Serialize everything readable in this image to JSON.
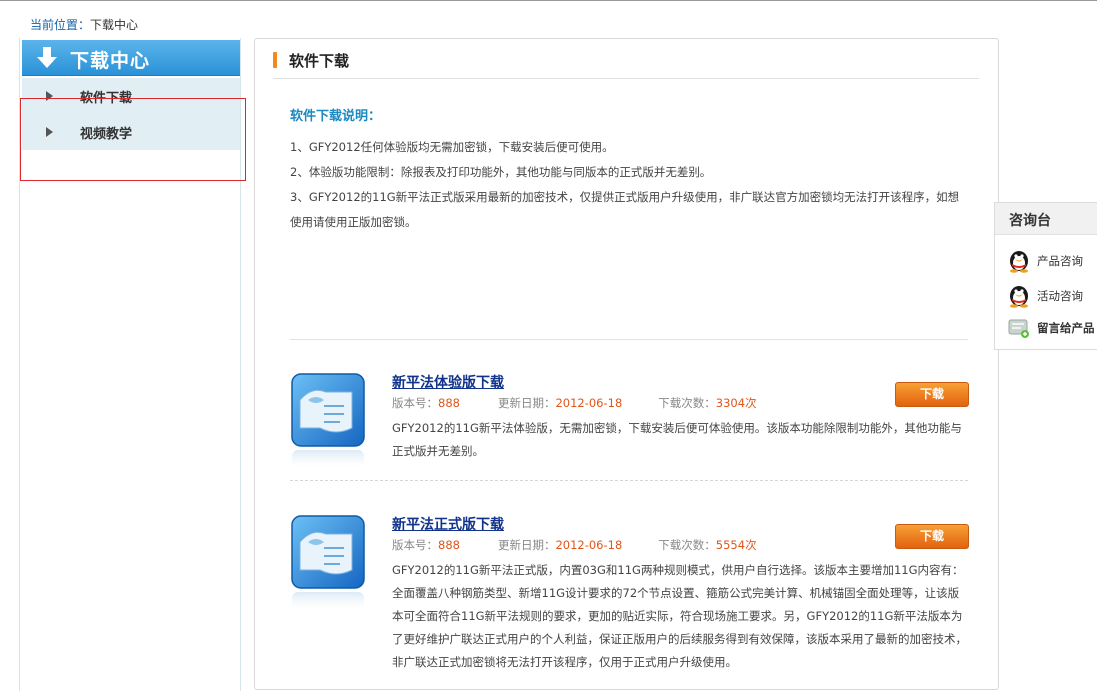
{
  "breadcrumb": {
    "prefix": "当前位置：",
    "current": "下载中心"
  },
  "sidebar": {
    "title": "下载中心",
    "items": [
      {
        "label": "软件下载"
      },
      {
        "label": "视频教学"
      }
    ]
  },
  "main": {
    "title": "软件下载",
    "notes_title": "软件下载说明：",
    "notes": [
      "1、GFY2012任何体验版均无需加密锁，下载安装后便可使用。",
      "2、体验版功能限制：除报表及打印功能外，其他功能与同版本的正式版并无差别。",
      "3、GFY2012的11G新平法正式版采用最新的加密技术，仅提供正式版用户升级使用，非广联达官方加密锁均无法打开该程序，如想使用请使用正版加密锁。"
    ],
    "downloads": [
      {
        "title": "新平法体验版下载",
        "version_label": "版本号：",
        "version": "888",
        "date_label": "更新日期：",
        "date": "2012-06-18",
        "count_label": "下载次数：",
        "count": "3304次",
        "button": "下载",
        "desc": "GFY2012的11G新平法体验版，无需加密锁，下载安装后便可体验使用。该版本功能除限制功能外，其他功能与正式版并无差别。"
      },
      {
        "title": "新平法正式版下载",
        "version_label": "版本号：",
        "version": "888",
        "date_label": "更新日期：",
        "date": "2012-06-18",
        "count_label": "下载次数：",
        "count": "5554次",
        "button": "下载",
        "desc": "GFY2012的11G新平法正式版，内置03G和11G两种规则模式，供用户自行选择。该版本主要增加11G内容有：全面覆盖八种钢筋类型、新增11G设计要求的72个节点设置、箍筋公式完美计算、机械锚固全面处理等，让该版本可全面符合11G新平法规则的要求，更加的贴近实际，符合现场施工要求。另，GFY2012的11G新平法版本为了更好维护广联达正式用户的个人利益，保证正版用户的后续服务得到有效保障，该版本采用了最新的加密技术，非广联达正式加密锁将无法打开该程序，仅用于正式用户升级使用。"
      }
    ]
  },
  "consult": {
    "title": "咨询台",
    "items": [
      {
        "label": "产品咨询",
        "icon": "qq-penguin-icon"
      },
      {
        "label": "活动咨询",
        "icon": "qq-penguin-icon"
      },
      {
        "label": "留言给产品",
        "icon": "message-board-icon"
      }
    ]
  },
  "colors": {
    "sidebar_header": "#2a92d8",
    "sidebar_bg": "#e1eff5",
    "accent_orange": "#f08a1c",
    "link_blue": "#11338c",
    "value_orange": "#e0561a",
    "notes_title": "#1c8ac0",
    "highlight_red": "#d9292f"
  }
}
